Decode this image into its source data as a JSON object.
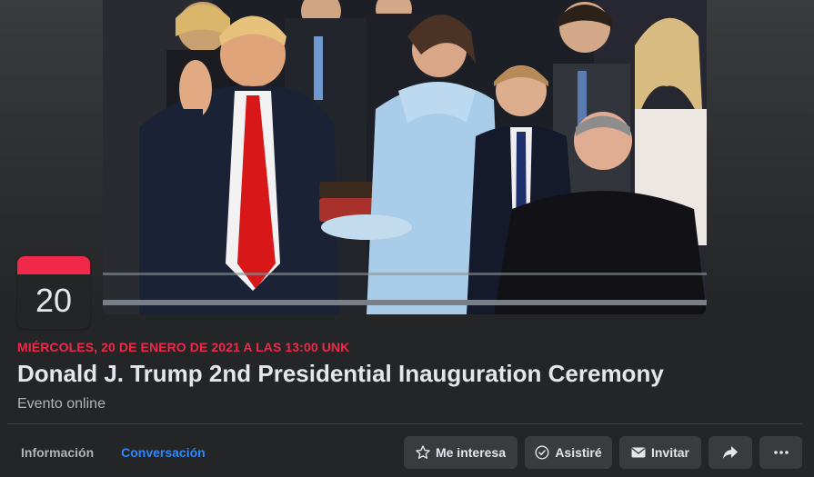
{
  "event": {
    "date_day": "20",
    "date_text": "MIÉRCOLES, 20 DE ENERO DE 2021 A LAS 13:00 UNK",
    "title": "Donald J. Trump 2nd Presidential Inauguration Ceremony",
    "location": "Evento online"
  },
  "tabs": [
    {
      "label": "Información",
      "active": false
    },
    {
      "label": "Conversación",
      "active": true
    }
  ],
  "actions": {
    "interested_label": "Me interesa",
    "going_label": "Asistiré",
    "invite_label": "Invitar",
    "share_icon": "share-icon",
    "more_icon": "more-icon"
  },
  "colors": {
    "accent_red": "#f02849",
    "link_blue": "#2d88ff",
    "background": "#242526",
    "button_bg": "#3a3b3c"
  }
}
